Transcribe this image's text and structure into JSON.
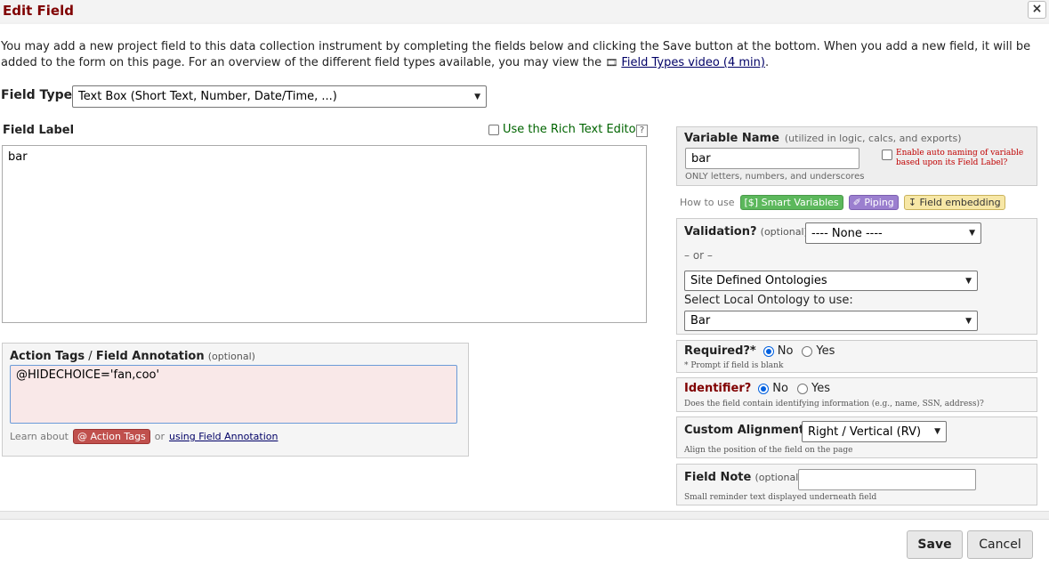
{
  "dialog": {
    "title": "Edit Field",
    "close_icon": "×"
  },
  "intro": {
    "text_before": "You may add a new project field to this data collection instrument by completing the fields below and clicking the Save button at the bottom. When you add a new field, it will be added to the form on this page. For an overview of the different field types available, you may view the ",
    "video_icon": "🎞",
    "video_link": "Field Types video (4 min)",
    "text_after": "."
  },
  "field_type": {
    "label": "Field Type:",
    "value": "Text Box (Short Text, Number, Date/Time, ...)"
  },
  "field_label": {
    "label": "Field Label",
    "rich_text_label": "Use the Rich Text Editor",
    "help": "?",
    "value": "bar"
  },
  "action_tags": {
    "label_bold": "Action Tags",
    "label_sep": " / ",
    "label_bold2": "Field Annotation",
    "optional": "(optional)",
    "value": "@HIDECHOICE='fan,coo'",
    "learn_about": "Learn about",
    "badge": "@ Action Tags",
    "or": "or",
    "link": "using Field Annotation"
  },
  "variable_name": {
    "label": "Variable Name",
    "hint": "(utilized in logic, calcs, and exports)",
    "value": "bar",
    "rule": "ONLY letters, numbers, and underscores",
    "auto_naming": "Enable auto naming of variable based upon its Field Label?"
  },
  "how_to_use": {
    "label": "How to use",
    "smart_variables": "[$] Smart Variables",
    "piping": "✐ Piping",
    "field_embedding": "↧ Field embedding"
  },
  "validation": {
    "label": "Validation?",
    "optional": "(optional)",
    "value": "---- None ----",
    "or": "– or –",
    "ontology_value": "Site Defined Ontologies",
    "local_label": "Select Local Ontology to use:",
    "local_value": "Bar"
  },
  "required": {
    "label": "Required?*",
    "no": "No",
    "yes": "Yes",
    "note": "* Prompt if field is blank"
  },
  "identifier": {
    "label": "Identifier?",
    "no": "No",
    "yes": "Yes",
    "note": "Does the field contain identifying information (e.g., name, SSN, address)?"
  },
  "alignment": {
    "label": "Custom Alignment",
    "value": "Right / Vertical (RV)",
    "note": "Align the position of the field on the page"
  },
  "field_note": {
    "label": "Field Note",
    "optional": "(optional)",
    "value": "",
    "note": "Small reminder text displayed underneath field"
  },
  "footer": {
    "save": "Save",
    "cancel": "Cancel"
  },
  "colors": {
    "title": "#800000",
    "identifier": "#800000",
    "annotation_bg": "#f9e8e8",
    "annotation_border": "#6b9bd8"
  }
}
